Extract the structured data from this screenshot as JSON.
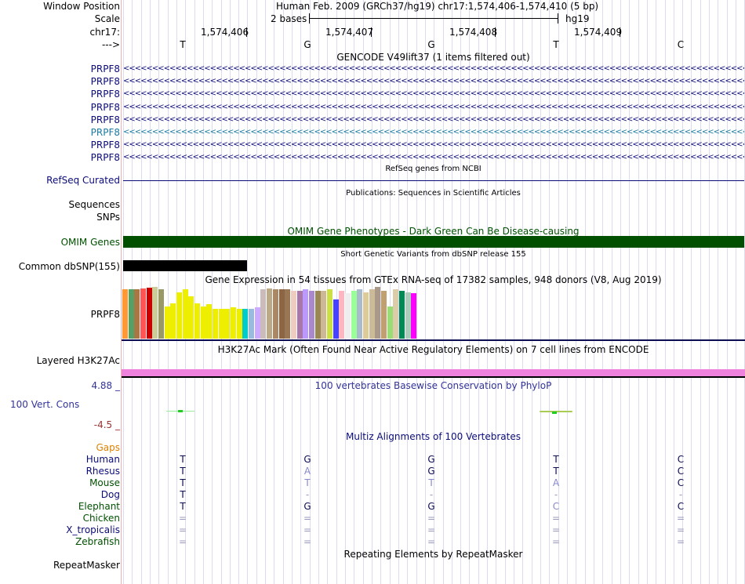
{
  "header": {
    "window_position_label": "Window Position",
    "scale_label": "Scale",
    "chrom_label": "chr17:",
    "strand_label": "--->",
    "position_text": "Human Feb. 2009 (GRCh37/hg19)   chr17:1,574,406-1,574,410 (5 bp)",
    "scale_text": "2 bases",
    "assembly": "hg19",
    "coords": [
      "1,574,406",
      "1,574,407",
      "1,574,408",
      "1,574,409"
    ],
    "bases": [
      "T",
      "G",
      "G",
      "T",
      "C"
    ]
  },
  "gencode": {
    "title": "GENCODE V49lift37 (1 items filtered out)",
    "genes": [
      "PRPF8",
      "PRPF8",
      "PRPF8",
      "PRPF8",
      "PRPF8",
      "PRPF8",
      "PRPF8",
      "PRPF8"
    ],
    "arrow_line": "<<<<<<<<<<<<<<<<<<<<<<<<<<<<<<<<<<<<<<<<<<<<<<<<<<<<<<<<<<<<<<<<<<<<<<<<<<<<<<<<<<<<<<<<<<<<<<<<<<<<<<<<<<<<<<<<<<<<<<<<<<<<<<<<<<<<<<<<<<<<<",
    "highlight_index": 5,
    "colors": {
      "gene": "#0c0c78",
      "highlight": "#1a7aa0"
    }
  },
  "refseq": {
    "title": "RefSeq genes from NCBI",
    "label": "RefSeq Curated"
  },
  "publications": {
    "title": "Publications: Sequences in Scientific Articles",
    "labels": [
      "Sequences",
      "SNPs"
    ]
  },
  "omim": {
    "title": "OMIM Gene Phenotypes - Dark Green Can Be Disease-causing",
    "label": "OMIM Genes",
    "color": "#005000"
  },
  "dbsnp": {
    "title": "Short Genetic Variants from dbSNP release 155",
    "label": "Common dbSNP(155)"
  },
  "gtex": {
    "title": "Gene Expression in 54 tissues from GTEx RNA-seq of 17382 samples, 948 donors (V8, Aug 2019)",
    "label": "PRPF8",
    "values": [
      0.95,
      0.95,
      0.96,
      0.97,
      0.98,
      1.0,
      0.96,
      0.62,
      0.68,
      0.9,
      0.95,
      0.82,
      0.68,
      0.62,
      0.66,
      0.58,
      0.58,
      0.58,
      0.6,
      0.58,
      0.58,
      0.58,
      0.6,
      0.95,
      0.97,
      0.96,
      0.96,
      0.95,
      0.92,
      0.92,
      0.95,
      0.93,
      0.92,
      0.93,
      0.95,
      0.75,
      0.92,
      0.88,
      0.92,
      0.95,
      0.9,
      0.95,
      1.0,
      0.92,
      0.62,
      0.95,
      0.92,
      0.9,
      0.88,
      0.9,
      0.95,
      0.95,
      0.92,
      0.62
    ],
    "colors": [
      "#ff9933",
      "#55a064",
      "#aa7744",
      "#ff5555",
      "#cc0000",
      "#cccc99",
      "#999966",
      "#eeee00",
      "#eeee00",
      "#eeee00",
      "#eeee00",
      "#eeee00",
      "#eeee00",
      "#eeee00",
      "#eeee00",
      "#eeee00",
      "#eeee00",
      "#eeee00",
      "#eeee00",
      "#eeee00",
      "#00cccc",
      "#99bbdd",
      "#ccaaff",
      "#ccbbbb",
      "#bbaa88",
      "#aa8866",
      "#8b6544",
      "#997755",
      "#eeccc0",
      "#aa77aa",
      "#bb99ff",
      "#aa88cc",
      "#998855",
      "#ccb896",
      "#cce044",
      "#4444ff",
      "#ffb6c1",
      "#eeeeee",
      "#99ff99",
      "#aabbcc",
      "#ddcc99",
      "#ccbb99",
      "#aa9988",
      "#c0a070",
      "#99dd77",
      "#ddccaa",
      "#008855",
      "#aaccbb",
      "#ff00ff"
    ]
  },
  "h3k27ac": {
    "title": "H3K27Ac Mark (Often Found Near Active Regulatory Elements) on 7 cell lines from ENCODE",
    "label": "Layered H3K27Ac",
    "color": "#ee82dd"
  },
  "phylop": {
    "title": "100 vertebrates Basewise Conservation by PhyloP",
    "label": "100 Vert. Cons",
    "max": "4.88 _",
    "min": "-4.5 _"
  },
  "multiz": {
    "title": "Multiz Alignments of 100 Vertebrates",
    "gaps_label": "Gaps",
    "species": [
      {
        "name": "Human",
        "bases": [
          "T",
          "G",
          "G",
          "T",
          "C"
        ]
      },
      {
        "name": "Rhesus",
        "bases": [
          "T",
          "A",
          "G",
          "T",
          "C"
        ]
      },
      {
        "name": "Mouse",
        "bases": [
          "T",
          "T",
          "T",
          "A",
          "C"
        ]
      },
      {
        "name": "Dog",
        "bases": [
          "T",
          "-",
          "-",
          "-",
          "-"
        ]
      },
      {
        "name": "Elephant",
        "bases": [
          "T",
          "G",
          "G",
          "C",
          "C"
        ]
      },
      {
        "name": "Chicken",
        "bases": [
          "=",
          "=",
          "=",
          "=",
          "="
        ]
      },
      {
        "name": "X_tropicalis",
        "bases": [
          "=",
          "=",
          "=",
          "=",
          "="
        ]
      },
      {
        "name": "Zebrafish",
        "bases": [
          "=",
          "=",
          "=",
          "=",
          "="
        ]
      }
    ]
  },
  "repeatmasker": {
    "title": "Repeating Elements by RepeatMasker",
    "label": "RepeatMasker"
  }
}
